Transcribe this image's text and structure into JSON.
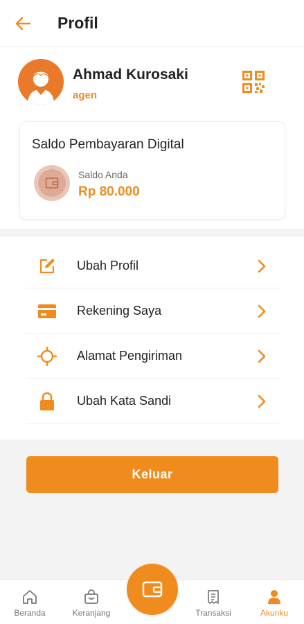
{
  "header": {
    "title": "Profil",
    "back_icon": "arrow-left-icon"
  },
  "profile": {
    "name": "Ahmad Kurosaki",
    "role": "agen",
    "avatar_icon": "user-avatar-icon",
    "qr_icon": "qr-code-icon"
  },
  "balance": {
    "title": "Saldo Pembayaran Digital",
    "label": "Saldo Anda",
    "amount": "Rp 80.000",
    "icon": "wallet-icon"
  },
  "menu": [
    {
      "label": "Ubah Profil",
      "icon": "edit-icon"
    },
    {
      "label": "Rekening Saya",
      "icon": "credit-card-icon"
    },
    {
      "label": "Alamat Pengiriman",
      "icon": "location-target-icon"
    },
    {
      "label": "Ubah Kata Sandi",
      "icon": "lock-icon"
    }
  ],
  "logout_label": "Keluar",
  "nav": [
    {
      "label": "Beranda",
      "icon": "home-icon",
      "active": false
    },
    {
      "label": "Keranjang",
      "icon": "cart-bag-icon",
      "active": false
    },
    {
      "label": "Transaksi",
      "icon": "receipt-icon",
      "active": false
    },
    {
      "label": "Akunku",
      "icon": "account-icon",
      "active": true
    }
  ],
  "fab_icon": "wallet-icon",
  "colors": {
    "accent": "#f08c1e",
    "background": "#f3f3f3",
    "text": "#222222"
  }
}
